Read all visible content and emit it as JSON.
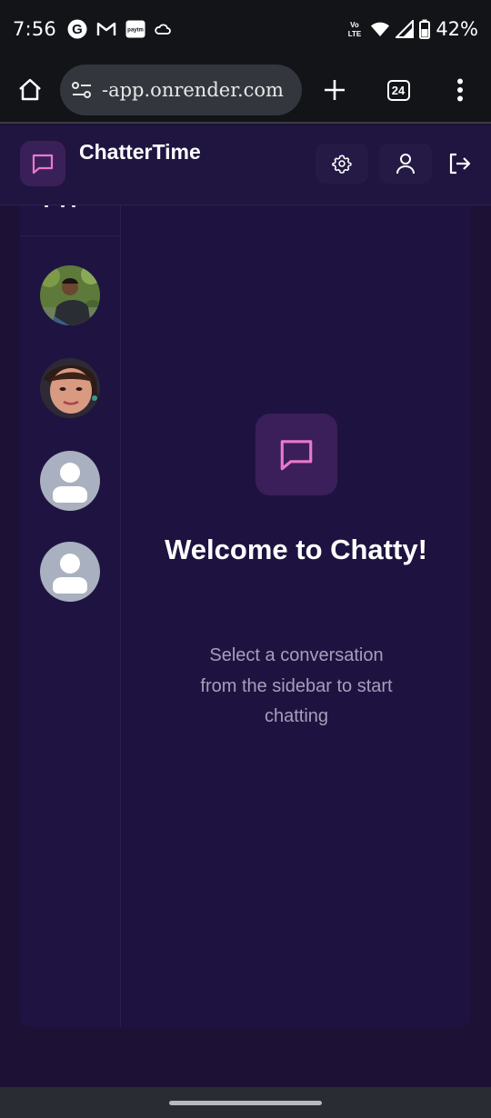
{
  "status_bar": {
    "time": "7:56",
    "left_icons": [
      "google-icon",
      "gmail-icon",
      "paytm-icon",
      "cloud-icon"
    ],
    "paytm_label": "paytm",
    "volte_label": "Vo LTE",
    "battery_percent": "42%"
  },
  "browser": {
    "url": "-app.onrender.com",
    "tab_count": "24"
  },
  "app": {
    "title": "ChatterTime",
    "accent_color": "#e879c9"
  },
  "sidebar": {
    "contacts": [
      {
        "avatar": "photo-man"
      },
      {
        "avatar": "photo-woman"
      },
      {
        "avatar": "default"
      },
      {
        "avatar": "default"
      }
    ]
  },
  "welcome": {
    "title": "Welcome to Chatty!",
    "subtitle": "Select a conversation from the sidebar to start chatting"
  }
}
